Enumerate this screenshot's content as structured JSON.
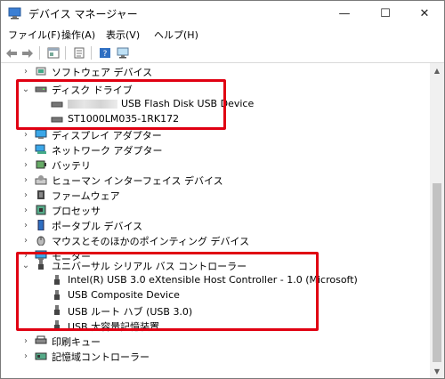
{
  "window": {
    "title": "デバイス マネージャー"
  },
  "window_buttons": {
    "minimize": "—",
    "maximize": "☐",
    "close": "✕"
  },
  "menu": [
    "ファイル(F)",
    "操作(A)",
    "表示(V)",
    "ヘルプ(H)"
  ],
  "toolbar_icons": [
    "back-icon",
    "forward-icon",
    "show-hide-icon",
    "properties-icon",
    "help-icon",
    "monitor-icon"
  ],
  "tree": [
    {
      "label": "ソフトウェア デバイス",
      "icon": "software-device-icon",
      "expanded": false
    },
    {
      "label": "ディスク ドライブ",
      "icon": "disk-drive-icon",
      "expanded": true,
      "children": [
        {
          "label": "USB Flash Disk USB Device",
          "icon": "drive-icon",
          "redacted_prefix": true
        },
        {
          "label": "ST1000LM035-1RK172",
          "icon": "drive-icon"
        }
      ]
    },
    {
      "label": "ディスプレイ アダプター",
      "icon": "display-adapter-icon",
      "expanded": false
    },
    {
      "label": "ネットワーク アダプター",
      "icon": "network-adapter-icon",
      "expanded": false
    },
    {
      "label": "バッテリ",
      "icon": "battery-icon",
      "expanded": false
    },
    {
      "label": "ヒューマン インターフェイス デバイス",
      "icon": "hid-icon",
      "expanded": false
    },
    {
      "label": "ファームウェア",
      "icon": "firmware-icon",
      "expanded": false
    },
    {
      "label": "プロセッサ",
      "icon": "processor-icon",
      "expanded": false
    },
    {
      "label": "ポータブル デバイス",
      "icon": "portable-device-icon",
      "expanded": false
    },
    {
      "label": "マウスとそのほかのポインティング デバイス",
      "icon": "mouse-icon",
      "expanded": false
    },
    {
      "label": "モニター",
      "icon": "monitor-icon",
      "expanded": false
    },
    {
      "label": "ユニバーサル シリアル バス コントローラー",
      "icon": "usb-controller-icon",
      "expanded": true,
      "children": [
        {
          "label": "Intel(R) USB 3.0 eXtensible Host Controller - 1.0 (Microsoft)",
          "icon": "usb-plug-icon"
        },
        {
          "label": "USB Composite Device",
          "icon": "usb-plug-icon"
        },
        {
          "label": "USB ルート ハブ (USB 3.0)",
          "icon": "usb-plug-icon"
        },
        {
          "label": "USB 大容量記憶装置",
          "icon": "usb-plug-icon"
        }
      ]
    },
    {
      "label": "印刷キュー",
      "icon": "print-queue-icon",
      "expanded": false
    },
    {
      "label": "記憶域コントローラー",
      "icon": "storage-controller-icon",
      "expanded": false
    }
  ],
  "colors": {
    "highlight": "#e00012",
    "scrollbar_thumb": "#c2c2c2",
    "icon_blue": "#2f6fc2"
  }
}
